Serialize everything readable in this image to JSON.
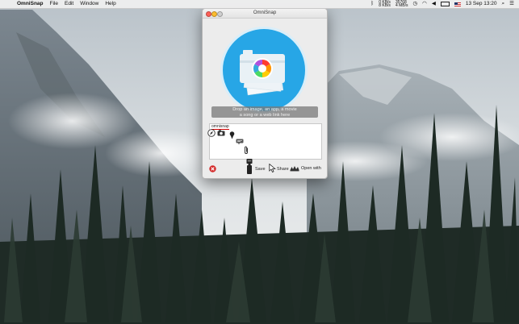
{
  "menubar": {
    "app_name": "OmniSnap",
    "items": [
      "File",
      "Edit",
      "Window",
      "Help"
    ],
    "network_top": "0 KB/s",
    "network_bottom": "8 KB/s",
    "net2_top": "35768",
    "net2_bottom": "4 MB/s",
    "datetime": "13 Sep 13:20"
  },
  "window": {
    "title": "OmniSnap",
    "drop_hint_line1": "Drop an image, an app, a movie",
    "drop_hint_line2": "a song or a web link here",
    "tag_label": "omnisnap",
    "actions": {
      "save": "Save",
      "share": "Share",
      "open_with": "Open with"
    }
  },
  "colors": {
    "close_light": "#fc5f57",
    "minimize_light": "#fdbc2e",
    "zoom_light": "#cfcfcf",
    "logo_blue": "#27a6e6",
    "logo_border": "#d9eef9",
    "remove_red": "#d42a2a"
  }
}
